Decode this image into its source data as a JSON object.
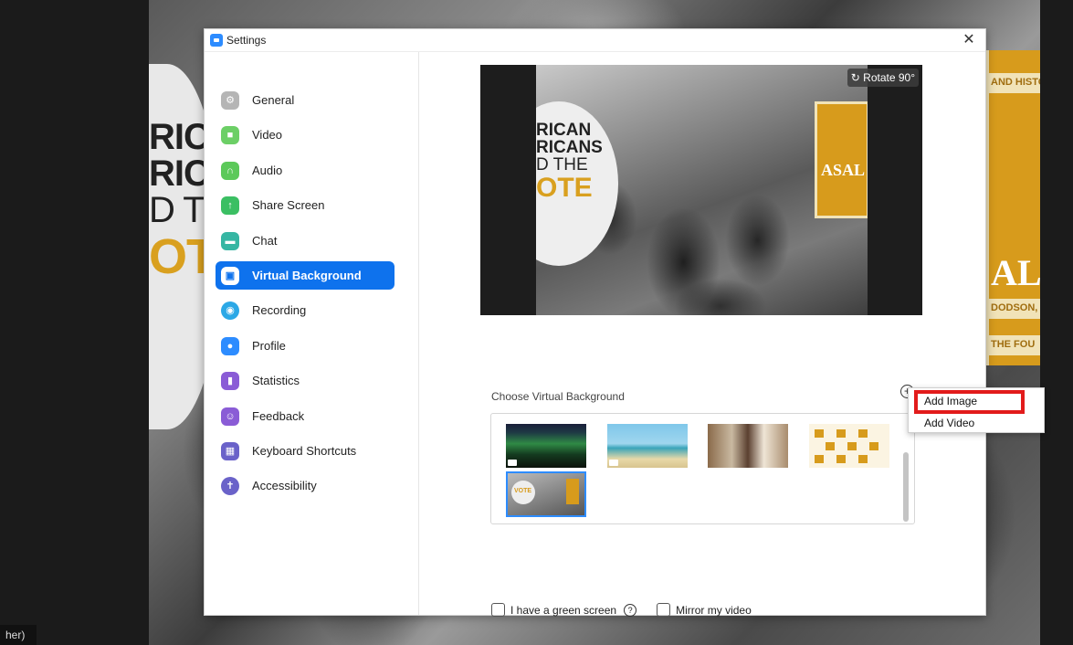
{
  "window": {
    "title": "Settings",
    "close_glyph": "✕"
  },
  "background_overlay": {
    "left_text_lines": [
      "RIC",
      "RIC",
      "D T",
      "OTE"
    ],
    "right_badge_top": "AND HISTO",
    "right_badge_mid": "DODSON, FO",
    "right_badge_bottom": "THE FOU",
    "right_badge_big": "AL",
    "bottom_tag": "her)"
  },
  "sidebar": {
    "items": [
      {
        "label": "General",
        "icon": "gear-icon",
        "color": "#a9a9a9"
      },
      {
        "label": "Video",
        "icon": "video-camera-icon",
        "color": "#5cc95a"
      },
      {
        "label": "Audio",
        "icon": "headphones-icon",
        "color": "#5cc95a"
      },
      {
        "label": "Share Screen",
        "icon": "share-screen-icon",
        "color": "#3bbf63"
      },
      {
        "label": "Chat",
        "icon": "chat-bubble-icon",
        "color": "#36b6a3"
      },
      {
        "label": "Virtual Background",
        "icon": "person-card-icon",
        "color": "#0e72ed",
        "active": true
      },
      {
        "label": "Recording",
        "icon": "record-icon",
        "color": "#2ba8e6"
      },
      {
        "label": "Profile",
        "icon": "profile-icon",
        "color": "#2d8cff"
      },
      {
        "label": "Statistics",
        "icon": "bar-chart-icon",
        "color": "#8a5cd6"
      },
      {
        "label": "Feedback",
        "icon": "smiley-icon",
        "color": "#8a5cd6"
      },
      {
        "label": "Keyboard Shortcuts",
        "icon": "keyboard-icon",
        "color": "#6a62c9"
      },
      {
        "label": "Accessibility",
        "icon": "accessibility-icon",
        "color": "#6a62c9"
      }
    ]
  },
  "preview": {
    "rotate_label": "Rotate 90°",
    "image_text": [
      "RICAN",
      "RICANS",
      "D THE",
      "OTE"
    ],
    "badge_text": "ASAL"
  },
  "virtual_background": {
    "choose_label": "Choose Virtual Background",
    "add_glyph": "+",
    "thumbnails": [
      "aurora",
      "beach",
      "room",
      "asalh-pattern",
      "vote-poster"
    ],
    "selected_index": 4,
    "thumb_vote_text": "VOTE"
  },
  "options": {
    "green_screen_label": "I have a green screen",
    "help_glyph": "?",
    "mirror_label": "Mirror my video"
  },
  "context_menu": {
    "items": [
      "Add Image",
      "Add Video"
    ],
    "highlight_color": "#e21b1b"
  }
}
